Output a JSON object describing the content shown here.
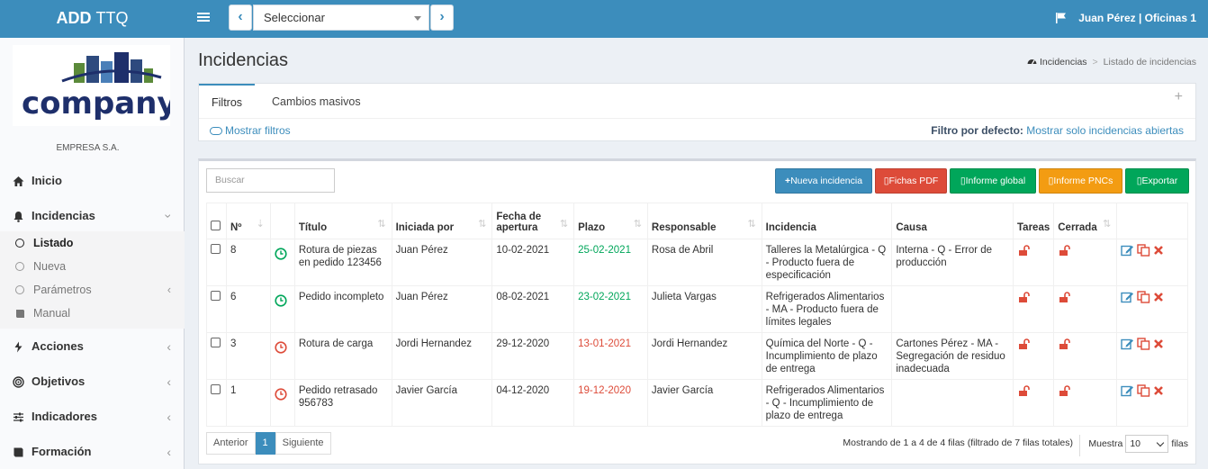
{
  "app": {
    "brand_bold": "ADD",
    "brand_rest": "TTQ"
  },
  "topbar": {
    "selector_value": "Seleccionar",
    "user": "Juan Pérez | Oficinas 1"
  },
  "sidebar": {
    "logo_text": "company",
    "company_name": "EMPRESA S.A.",
    "items": [
      {
        "label": "Inicio"
      },
      {
        "label": "Incidencias"
      },
      {
        "label": "Acciones"
      },
      {
        "label": "Objetivos"
      },
      {
        "label": "Indicadores"
      },
      {
        "label": "Formación"
      }
    ],
    "subitems": [
      {
        "label": "Listado"
      },
      {
        "label": "Nueva"
      },
      {
        "label": "Parámetros"
      },
      {
        "label": "Manual"
      }
    ]
  },
  "page": {
    "title": "Incidencias",
    "breadcrumb": [
      "Incidencias",
      "Listado de incidencias"
    ]
  },
  "filters": {
    "tabs": [
      "Filtros",
      "Cambios masivos"
    ],
    "show_filters": "Mostrar filtros",
    "default_label": "Filtro por defecto:",
    "default_value": "Mostrar solo incidencias abiertas"
  },
  "toolbar": {
    "search_placeholder": "Buscar",
    "buttons": [
      "Nueva incidencia",
      "Fichas PDF",
      "Informe global",
      "Informe PNCs",
      "Exportar"
    ],
    "colors": {
      "blue": "#3c8dbc",
      "red": "#dd4b39",
      "green": "#00a65a",
      "orange": "#f39c12"
    }
  },
  "table": {
    "headers": [
      "Nº",
      "Título",
      "Iniciada por",
      "Fecha de apertura",
      "Plazo",
      "Responsable",
      "Incidencia",
      "Causa",
      "Tareas",
      "Cerrada"
    ],
    "rows": [
      {
        "n": "8",
        "status": "green",
        "titulo": "Rotura de piezas en pedido 123456",
        "iniciada": "Juan Pérez",
        "fecha": "10-02-2021",
        "plazo": "25-02-2021",
        "plazo_color": "green",
        "responsable": "Rosa de Abril",
        "incidencia": "Talleres la Metalúrgica - Q - Producto fuera de especificación",
        "causa": "Interna - Q - Error de producción"
      },
      {
        "n": "6",
        "status": "green",
        "titulo": "Pedido incompleto",
        "iniciada": "Juan Pérez",
        "fecha": "08-02-2021",
        "plazo": "23-02-2021",
        "plazo_color": "green",
        "responsable": "Julieta Vargas",
        "incidencia": "Refrigerados Alimentarios - MA - Producto fuera de límites legales",
        "causa": ""
      },
      {
        "n": "3",
        "status": "red",
        "titulo": "Rotura de carga",
        "iniciada": "Jordi Hernandez",
        "fecha": "29-12-2020",
        "plazo": "13-01-2021",
        "plazo_color": "red",
        "responsable": "Jordi Hernandez",
        "incidencia": "Química del Norte - Q - Incumplimiento de plazo de entrega",
        "causa": "Cartones Pérez - MA - Segregación de residuo inadecuada"
      },
      {
        "n": "1",
        "status": "red",
        "titulo": "Pedido retrasado 956783",
        "iniciada": "Javier García",
        "fecha": "04-12-2020",
        "plazo": "19-12-2020",
        "plazo_color": "red",
        "responsable": "Javier García",
        "incidencia": "Refrigerados Alimentarios - Q - Incumplimiento de plazo de entrega",
        "causa": ""
      }
    ]
  },
  "footer": {
    "prev": "Anterior",
    "page": "1",
    "next": "Siguiente",
    "info": "Mostrando de 1 a 4 de 4 filas (filtrado de 7 filas totales)",
    "show_label": "Muestra",
    "page_size": "10",
    "rows_label": "filas"
  }
}
